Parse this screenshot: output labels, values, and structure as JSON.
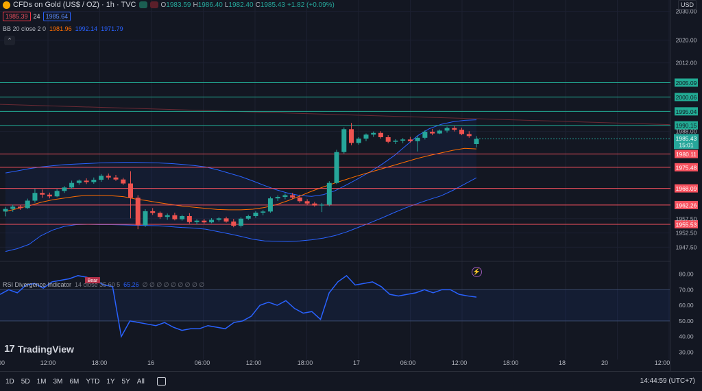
{
  "header": {
    "title": "CFDs on Gold (US$ / OZ) · 1h · TVC",
    "ohlc": [
      {
        "k": "O",
        "v": "1983.59"
      },
      {
        "k": "H",
        "v": "1986.40"
      },
      {
        "k": "L",
        "v": "1982.40"
      },
      {
        "k": "C",
        "v": "1985.43"
      },
      {
        "k": "",
        "v": "+1.82 (+0.09%)"
      }
    ],
    "sell_price": "1985.39",
    "spread": "24",
    "buy_price": "1985.64",
    "currency": "USD"
  },
  "bb_legend": {
    "name": "BB 20 close 2 0",
    "basis": "1981.96",
    "upper": "1992.14",
    "lower": "1971.79"
  },
  "rsi_legend": {
    "name": "RSI Divergence Indicator",
    "params": "14 close 35 60 5",
    "value": "65.26",
    "tail": "∅ ∅ ∅ ∅ ∅ ∅ ∅ ∅ ∅"
  },
  "brand": "TradingView",
  "timeframes": [
    "1D",
    "5D",
    "1M",
    "3M",
    "6M",
    "YTD",
    "1Y",
    "5Y",
    "All"
  ],
  "clock": "14:44:59 (UTC+7)",
  "colors": {
    "bg": "#131722",
    "up": "#26a69a",
    "down": "#ef5350",
    "bb_band": "#2962ff",
    "bb_basis": "#ff6d00",
    "rsi": "#2962ff",
    "green_line": "#22ab94",
    "red_line": "#f7525f"
  },
  "chart_data": [
    {
      "type": "candlestick",
      "title": "CFDs on Gold (US$ / OZ)",
      "ylim": [
        1944,
        2034
      ],
      "y_ticks": [
        "2030.00",
        "2020.00",
        "2012.00",
        "1988.00",
        "1957.50",
        "1952.50",
        "1947.50"
      ],
      "x_ticks": [
        "00",
        "12:00",
        "18:00",
        "16",
        "06:00",
        "12:00",
        "18:00",
        "17",
        "06:00",
        "12:00",
        "18:00",
        "18",
        "20",
        "12:00"
      ],
      "candles": [
        [
          1960.0,
          1961.6,
          1958.3,
          1960.9
        ],
        [
          1960.9,
          1962.4,
          1959.9,
          1961.7
        ],
        [
          1961.7,
          1962.3,
          1960.6,
          1961.2
        ],
        [
          1961.2,
          1964.5,
          1960.9,
          1963.8
        ],
        [
          1963.8,
          1967.9,
          1963.1,
          1966.5
        ],
        [
          1966.5,
          1967.7,
          1964.8,
          1965.9
        ],
        [
          1965.9,
          1966.6,
          1964.6,
          1965.3
        ],
        [
          1965.3,
          1967.8,
          1965.0,
          1967.2
        ],
        [
          1967.2,
          1968.9,
          1966.5,
          1968.4
        ],
        [
          1968.4,
          1970.8,
          1967.9,
          1970.0
        ],
        [
          1970.0,
          1971.2,
          1969.4,
          1970.8
        ],
        [
          1970.8,
          1971.6,
          1969.6,
          1970.3
        ],
        [
          1970.3,
          1971.9,
          1969.7,
          1971.1
        ],
        [
          1971.1,
          1973.1,
          1970.4,
          1972.5
        ],
        [
          1972.5,
          1973.3,
          1971.2,
          1971.9
        ],
        [
          1971.9,
          1972.8,
          1970.7,
          1971.2
        ],
        [
          1971.2,
          1971.8,
          1969.3,
          1969.8
        ],
        [
          1969.8,
          1974.1,
          1957.6,
          1964.8
        ],
        [
          1964.8,
          1965.7,
          1953.8,
          1955.2
        ],
        [
          1955.2,
          1960.8,
          1954.6,
          1960.1
        ],
        [
          1960.1,
          1961.2,
          1958.8,
          1959.5
        ],
        [
          1959.5,
          1960.0,
          1957.4,
          1958.1
        ],
        [
          1958.1,
          1959.3,
          1957.1,
          1958.7
        ],
        [
          1958.7,
          1959.6,
          1956.9,
          1957.3
        ],
        [
          1957.3,
          1958.9,
          1956.8,
          1958.4
        ],
        [
          1958.4,
          1959.4,
          1955.8,
          1956.3
        ],
        [
          1956.3,
          1957.3,
          1955.4,
          1956.8
        ],
        [
          1956.8,
          1957.4,
          1955.8,
          1956.2
        ],
        [
          1956.2,
          1957.7,
          1955.9,
          1957.1
        ],
        [
          1957.1,
          1958.0,
          1956.5,
          1957.6
        ],
        [
          1957.6,
          1958.2,
          1956.1,
          1956.5
        ],
        [
          1956.5,
          1957.4,
          1954.5,
          1955.0
        ],
        [
          1955.0,
          1958.0,
          1954.4,
          1957.5
        ],
        [
          1957.5,
          1958.9,
          1957.0,
          1958.4
        ],
        [
          1958.4,
          1960.1,
          1957.8,
          1959.6
        ],
        [
          1959.6,
          1960.5,
          1958.7,
          1960.0
        ],
        [
          1960.0,
          1965.2,
          1959.6,
          1964.6
        ],
        [
          1964.6,
          1965.7,
          1963.7,
          1965.1
        ],
        [
          1965.1,
          1966.3,
          1964.3,
          1965.7
        ],
        [
          1965.7,
          1966.5,
          1964.4,
          1964.9
        ],
        [
          1964.9,
          1965.9,
          1963.0,
          1963.6
        ],
        [
          1963.6,
          1964.3,
          1962.2,
          1962.8
        ],
        [
          1962.8,
          1963.4,
          1961.7,
          1962.1
        ],
        [
          1962.1,
          1963.0,
          1959.8,
          1962.4
        ],
        [
          1962.4,
          1970.6,
          1961.9,
          1970.0
        ],
        [
          1970.0,
          1981.6,
          1969.6,
          1980.8
        ],
        [
          1980.8,
          1989.4,
          1980.3,
          1988.8
        ],
        [
          1988.8,
          1991.0,
          1983.2,
          1984.0
        ],
        [
          1984.0,
          1986.0,
          1983.4,
          1985.5
        ],
        [
          1985.5,
          1987.3,
          1984.6,
          1986.9
        ],
        [
          1986.9,
          1988.0,
          1986.1,
          1987.5
        ],
        [
          1987.5,
          1988.1,
          1985.5,
          1986.0
        ],
        [
          1986.0,
          1986.7,
          1983.9,
          1984.4
        ],
        [
          1984.4,
          1985.3,
          1983.6,
          1984.8
        ],
        [
          1984.8,
          1985.7,
          1983.9,
          1985.2
        ],
        [
          1985.2,
          1986.1,
          1984.1,
          1984.6
        ],
        [
          1984.6,
          1986.5,
          1981.0,
          1985.8
        ],
        [
          1985.8,
          1988.4,
          1985.2,
          1987.9
        ],
        [
          1987.9,
          1988.9,
          1986.7,
          1987.3
        ],
        [
          1987.3,
          1988.7,
          1987.1,
          1988.3
        ],
        [
          1988.3,
          1989.7,
          1987.6,
          1989.2
        ],
        [
          1989.2,
          1989.9,
          1988.0,
          1988.6
        ],
        [
          1988.6,
          1989.3,
          1986.7,
          1987.1
        ],
        [
          1987.1,
          1988.1,
          1985.8,
          1986.4
        ],
        [
          1983.6,
          1986.4,
          1982.4,
          1985.4
        ]
      ],
      "bb_upper": [
        1973.5,
        1974.2,
        1975.0,
        1975.6,
        1976.0,
        1976.4,
        1976.6,
        1976.8,
        1977.0,
        1977.1,
        1977.2,
        1977.2,
        1977.1,
        1977.0,
        1976.8,
        1976.5,
        1976.1,
        1975.6,
        1974.6,
        1973.4,
        1972.2,
        1970.7,
        1969.1,
        1967.6,
        1966.4,
        1965.6,
        1965.3,
        1965.9,
        1967.3,
        1969.4,
        1971.6,
        1974.0,
        1976.6,
        1979.5,
        1983.0,
        1986.5,
        1989.0,
        1990.5,
        1991.4,
        1991.9,
        1992.1
      ],
      "bb_basis": [
        1960.0,
        1961.0,
        1962.0,
        1963.2,
        1964.1,
        1964.7,
        1965.3,
        1965.7,
        1965.7,
        1965.5,
        1965.2,
        1964.4,
        1963.8,
        1963.1,
        1962.5,
        1961.9,
        1961.5,
        1961.1,
        1960.7,
        1960.6,
        1960.6,
        1960.8,
        1961.4,
        1962.4,
        1963.8,
        1965.4,
        1967.1,
        1968.6,
        1970.0,
        1971.3,
        1972.6,
        1973.8,
        1975.0,
        1976.2,
        1977.4,
        1978.6,
        1979.6,
        1980.5,
        1981.4,
        1982.1,
        1981.9
      ],
      "bb_lower": [
        1946.0,
        1947.0,
        1948.5,
        1951.5,
        1953.5,
        1954.8,
        1955.4,
        1955.5,
        1955.4,
        1955.4,
        1955.3,
        1955.2,
        1955.1,
        1955.0,
        1954.7,
        1954.4,
        1954.2,
        1953.8,
        1953.0,
        1952.2,
        1951.3,
        1950.3,
        1949.7,
        1949.6,
        1949.5,
        1949.7,
        1950.1,
        1950.7,
        1951.6,
        1952.9,
        1954.5,
        1956.1,
        1957.8,
        1959.6,
        1961.3,
        1962.8,
        1964.2,
        1965.5,
        1967.4,
        1969.6,
        1971.8
      ]
    },
    {
      "type": "line",
      "title": "RSI Divergence Indicator",
      "ylim": [
        28,
        82
      ],
      "y_ticks": [
        "80.00",
        "70.00",
        "60.00",
        "50.00",
        "40.00",
        "30.00"
      ],
      "band": [
        50,
        70
      ],
      "values": [
        67,
        70,
        68,
        73,
        74,
        71,
        75,
        76,
        77,
        79,
        78,
        76,
        73,
        72,
        40,
        50,
        49,
        48,
        47,
        49,
        46,
        44,
        45,
        45,
        47,
        46,
        45,
        49,
        50,
        53,
        60,
        62,
        60,
        63,
        58,
        55,
        56,
        51,
        68,
        75,
        79,
        73,
        74,
        75,
        72,
        67,
        66,
        67,
        68,
        70,
        68,
        70,
        70,
        67,
        66,
        65.26
      ]
    }
  ],
  "price_levels": [
    {
      "label": "2005.09",
      "value": 2005.09,
      "kind": "green"
    },
    {
      "label": "2000.06",
      "value": 2000.06,
      "kind": "green"
    },
    {
      "label": "1995.04",
      "value": 1995.04,
      "kind": "green"
    },
    {
      "label": "1990.15",
      "value": 1990.15,
      "kind": "green"
    },
    {
      "label": "1980.11",
      "value": 1980.11,
      "kind": "red"
    },
    {
      "label": "1975.48",
      "value": 1975.48,
      "kind": "red"
    },
    {
      "label": "1968.09",
      "value": 1968.09,
      "kind": "red"
    },
    {
      "label": "1962.26",
      "value": 1962.26,
      "kind": "red"
    },
    {
      "label": "1955.53",
      "value": 1955.53,
      "kind": "red"
    }
  ],
  "last_price": {
    "value": 1985.43,
    "label": "1985.43",
    "countdown": "15:01"
  },
  "rsi_bear_marker": "Bear"
}
